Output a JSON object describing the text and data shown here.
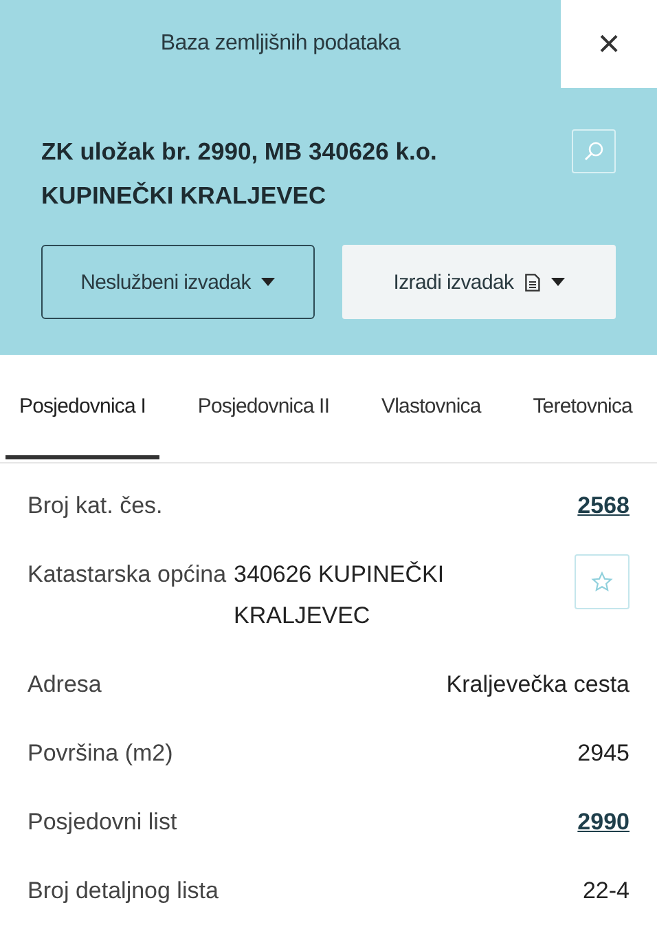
{
  "header": {
    "title": "Baza zemljišnih podataka",
    "close": "×"
  },
  "record": {
    "heading": "ZK uložak br. 2990, MB 340626 k.o. KUPINEČKI KRALJEVEC"
  },
  "buttons": [
    {
      "label": "Neslužbeni izvadak",
      "kind": "outline"
    },
    {
      "label": "Izradi izvadak",
      "kind": "document"
    }
  ],
  "tabs": [
    {
      "label": "Posjedovnica I",
      "selected": true
    },
    {
      "label": "Posjedovnica II",
      "selected": false
    },
    {
      "label": "Vlastovnica",
      "selected": false
    },
    {
      "label": "Teretovnica",
      "selected": false
    }
  ],
  "rows": [
    {
      "label": "Broj kat. čes.",
      "value": "2568",
      "kind": "link"
    },
    {
      "label": "Katastarska općina",
      "value": "340626 KUPINEČKI KRALJEVEC",
      "kind": "favorite"
    },
    {
      "label": "Adresa",
      "value": "Kraljevečka cesta",
      "kind": "text"
    },
    {
      "label": "Površina (m2)",
      "value": "2945",
      "kind": "text"
    },
    {
      "label": "Posjedovni list",
      "value": "2990",
      "kind": "link"
    },
    {
      "label": "Broj detaljnog lista",
      "value": "22-4",
      "kind": "text"
    }
  ]
}
